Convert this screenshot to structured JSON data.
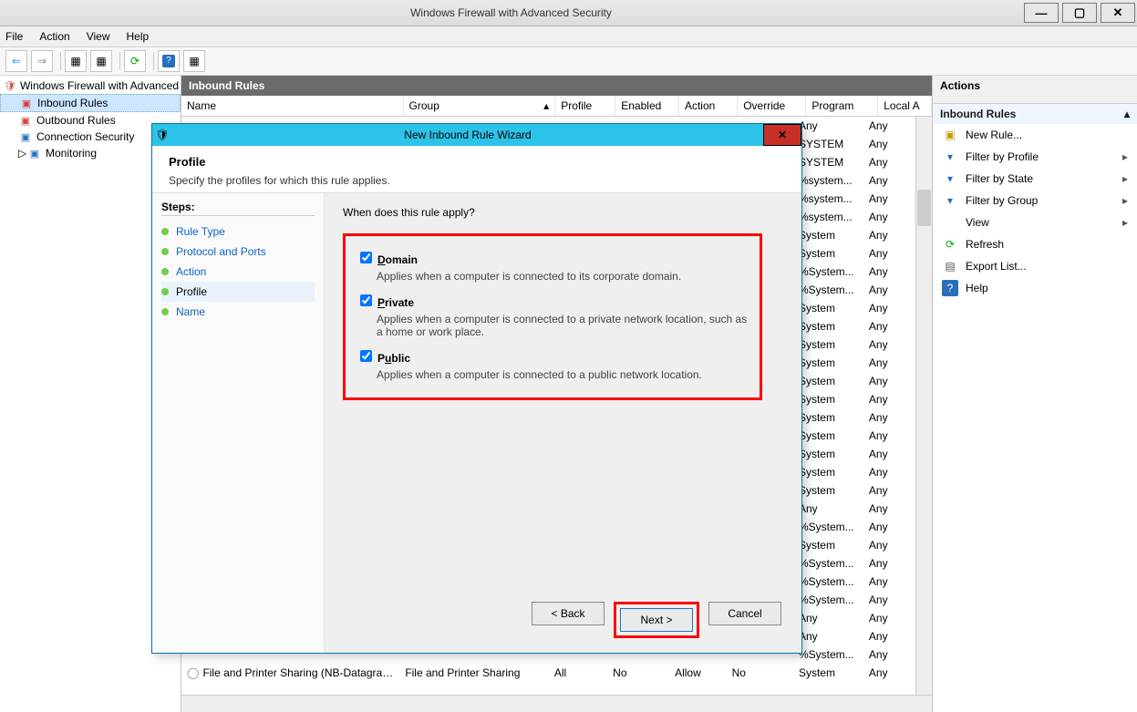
{
  "titlebar": {
    "title": "Windows Firewall with Advanced Security"
  },
  "menu": {
    "file": "File",
    "action": "Action",
    "view": "View",
    "help": "Help"
  },
  "tree": {
    "root": "Windows Firewall with Advanced Security",
    "inbound": "Inbound Rules",
    "outbound": "Outbound Rules",
    "connection": "Connection Security",
    "monitoring": "Monitoring"
  },
  "mid": {
    "heading": "Inbound Rules",
    "columns": {
      "name": "Name",
      "group": "Group",
      "profile": "Profile",
      "enabled": "Enabled",
      "action": "Action",
      "override": "Override",
      "program": "Program",
      "local": "Local A"
    },
    "visibleRows": [
      {
        "program": "Any",
        "local": "Any"
      },
      {
        "program": "SYSTEM",
        "local": "Any"
      },
      {
        "program": "SYSTEM",
        "local": "Any"
      },
      {
        "program": "%system...",
        "local": "Any"
      },
      {
        "program": "%system...",
        "local": "Any"
      },
      {
        "program": "%system...",
        "local": "Any"
      },
      {
        "program": "System",
        "local": "Any"
      },
      {
        "program": "System",
        "local": "Any"
      },
      {
        "program": "%System...",
        "local": "Any"
      },
      {
        "program": "%System...",
        "local": "Any"
      },
      {
        "program": "System",
        "local": "Any"
      },
      {
        "program": "System",
        "local": "Any"
      },
      {
        "program": "System",
        "local": "Any"
      },
      {
        "program": "System",
        "local": "Any"
      },
      {
        "program": "System",
        "local": "Any"
      },
      {
        "program": "System",
        "local": "Any"
      },
      {
        "program": "System",
        "local": "Any"
      },
      {
        "program": "System",
        "local": "Any"
      },
      {
        "program": "System",
        "local": "Any"
      },
      {
        "program": "System",
        "local": "Any"
      },
      {
        "program": "System",
        "local": "Any"
      },
      {
        "program": "Any",
        "local": "Any"
      },
      {
        "program": "%System...",
        "local": "Any"
      },
      {
        "program": "System",
        "local": "Any"
      },
      {
        "program": "%System...",
        "local": "Any"
      },
      {
        "program": "%System...",
        "local": "Any"
      },
      {
        "program": "%System...",
        "local": "Any"
      },
      {
        "program": "Any",
        "local": "Any"
      },
      {
        "program": "Any",
        "local": "Any"
      },
      {
        "program": "%System...",
        "local": "Any"
      }
    ],
    "bottomRow": {
      "name": "File and Printer Sharing (NB-Datagram-In)",
      "group": "File and Printer Sharing",
      "profile": "All",
      "enabled": "No",
      "action": "Allow",
      "override": "No",
      "program": "System",
      "local": "Any"
    }
  },
  "actions": {
    "heading": "Actions",
    "sub": "Inbound Rules",
    "items": [
      {
        "icon": "newrule",
        "label": "New Rule..."
      },
      {
        "icon": "filter",
        "label": "Filter by Profile",
        "sub": true
      },
      {
        "icon": "filter",
        "label": "Filter by State",
        "sub": true
      },
      {
        "icon": "filter",
        "label": "Filter by Group",
        "sub": true
      },
      {
        "icon": "",
        "label": "View",
        "sub": true
      },
      {
        "icon": "refresh",
        "label": "Refresh"
      },
      {
        "icon": "export",
        "label": "Export List..."
      },
      {
        "icon": "help",
        "label": "Help"
      }
    ]
  },
  "wizard": {
    "title": "New Inbound Rule Wizard",
    "heading": "Profile",
    "sub": "Specify the profiles for which this rule applies.",
    "stepsHeading": "Steps:",
    "steps": [
      "Rule Type",
      "Protocol and Ports",
      "Action",
      "Profile",
      "Name"
    ],
    "currentStep": "Profile",
    "question": "When does this rule apply?",
    "profiles": [
      {
        "name": "Domain",
        "desc": "Applies when a computer is connected to its corporate domain.",
        "checked": true,
        "key": "D"
      },
      {
        "name": "Private",
        "desc": "Applies when a computer is connected to a private network location, such as a home or work place.",
        "checked": true,
        "key": "P"
      },
      {
        "name": "Public",
        "desc": "Applies when a computer is connected to a public network location.",
        "checked": true,
        "key": "u"
      }
    ],
    "buttons": {
      "back": "< Back",
      "next": "Next >",
      "cancel": "Cancel"
    }
  }
}
